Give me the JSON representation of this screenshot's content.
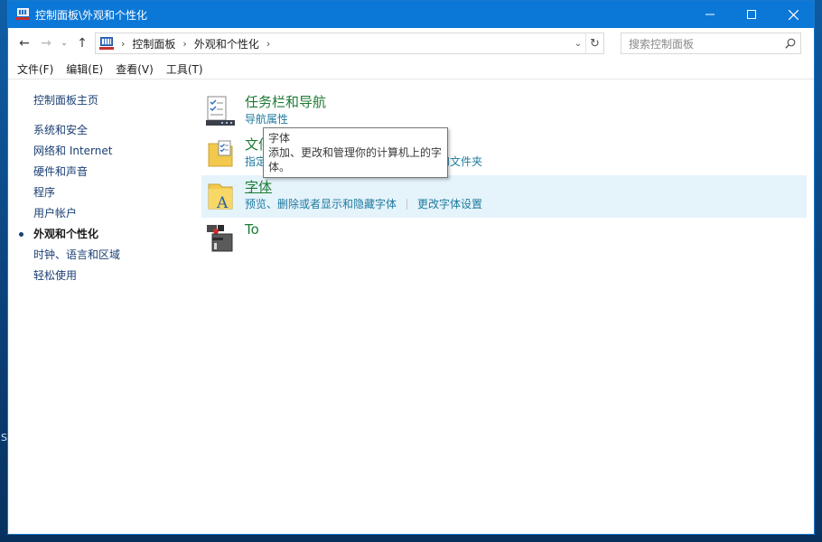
{
  "window": {
    "title": "控制面板\\外观和个性化",
    "controls": {
      "minimize": "—",
      "maximize": "☐",
      "close": "✕"
    }
  },
  "nav": {
    "back": "←",
    "forward": "→",
    "recent": "⌄",
    "up": "↑",
    "breadcrumb": [
      "控制面板",
      "外观和个性化"
    ],
    "refresh": "↻",
    "search_placeholder": "搜索控制面板"
  },
  "menubar": [
    "文件(F)",
    "编辑(E)",
    "查看(V)",
    "工具(T)"
  ],
  "sidebar": {
    "home": "控制面板主页",
    "items": [
      {
        "label": "系统和安全",
        "active": false
      },
      {
        "label": "网络和 Internet",
        "active": false
      },
      {
        "label": "硬件和声音",
        "active": false
      },
      {
        "label": "程序",
        "active": false
      },
      {
        "label": "用户帐户",
        "active": false
      },
      {
        "label": "外观和个性化",
        "active": true
      },
      {
        "label": "时钟、语言和区域",
        "active": false
      },
      {
        "label": "轻松使用",
        "active": false
      }
    ]
  },
  "categories": [
    {
      "title": "任务栏和导航",
      "icon": "taskbar-icon",
      "links": [
        "导航属性"
      ]
    },
    {
      "title": "文件资源管理器选项",
      "icon": "folder-options-icon",
      "links": [
        "指定单击或双击打开",
        "显示隐藏的文件和文件夹"
      ]
    },
    {
      "title": "字体",
      "icon": "fonts-icon",
      "links": [
        "预览、删除或者显示和隐藏字体",
        "更改字体设置"
      ]
    },
    {
      "title": "To",
      "icon": "tool-icon",
      "links": []
    }
  ],
  "tooltip": {
    "line1": "字体",
    "line2": "添加、更改和管理你的计算机上的字",
    "line3": "体。"
  },
  "desktop": {
    "letter": "S"
  },
  "colors": {
    "titlebar": "#0b78d7",
    "category_title": "#1e7b34",
    "link": "#1e7a9e",
    "highlight": "#e5f3fb"
  }
}
